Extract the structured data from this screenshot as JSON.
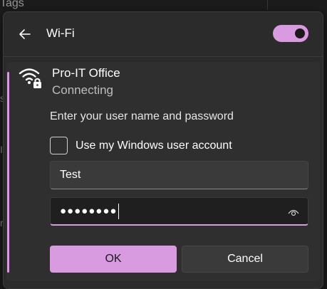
{
  "background": {
    "tags_label": "Tags",
    "edge_fragments": [
      "s",
      "I",
      "r"
    ]
  },
  "header": {
    "back_icon": "back-arrow-icon",
    "title": "Wi-Fi",
    "toggle_on": true
  },
  "network": {
    "icon": "wifi-secured-icon",
    "name": "Pro-IT Office",
    "status": "Connecting"
  },
  "form": {
    "prompt": "Enter your user name and password",
    "checkbox_label": "Use my Windows user account",
    "checkbox_checked": false,
    "username_value": "Test",
    "password_mask": "●●●●●●●●",
    "reveal_icon": "eye-icon",
    "ok_label": "OK",
    "cancel_label": "Cancel"
  },
  "colors": {
    "accent": "#d89be0",
    "panel": "#2b2b2b",
    "card": "#2f2f2f"
  }
}
